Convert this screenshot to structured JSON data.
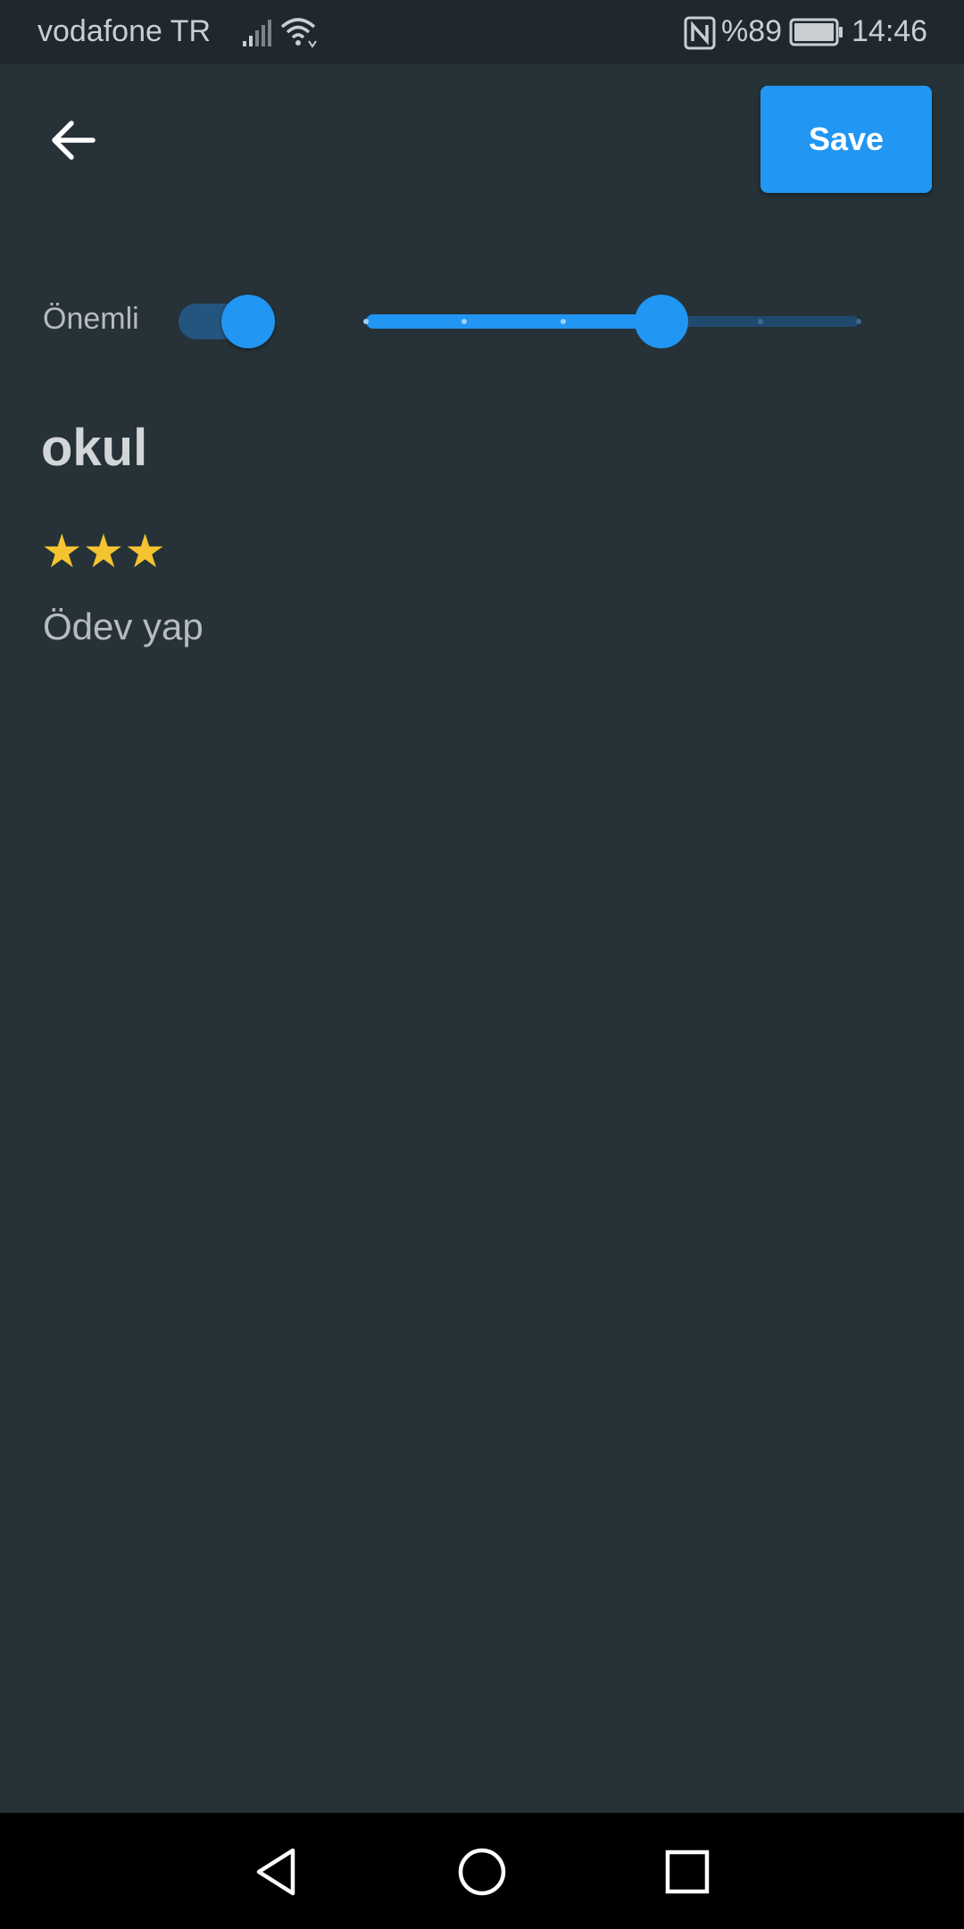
{
  "status_bar": {
    "carrier": "vodafone TR",
    "battery_percent": "%89",
    "time": "14:46",
    "icons": [
      "signal-icon",
      "wifi-icon",
      "nfc-icon",
      "battery-icon"
    ]
  },
  "app_bar": {
    "back_icon": "arrow-left-icon",
    "save_label": "Save"
  },
  "importance": {
    "label": "Önemli",
    "switch_on": true,
    "slider": {
      "min": 0,
      "max": 5,
      "value": 3
    }
  },
  "note": {
    "title": "okul",
    "stars": "★★★",
    "star_count": 3,
    "description": "Ödev yap"
  },
  "nav_bar": {
    "icons": [
      "back-triangle-icon",
      "home-circle-icon",
      "recents-square-icon"
    ]
  },
  "colors": {
    "background": "#263238",
    "accent": "#2196f3",
    "star": "#f4c430"
  }
}
